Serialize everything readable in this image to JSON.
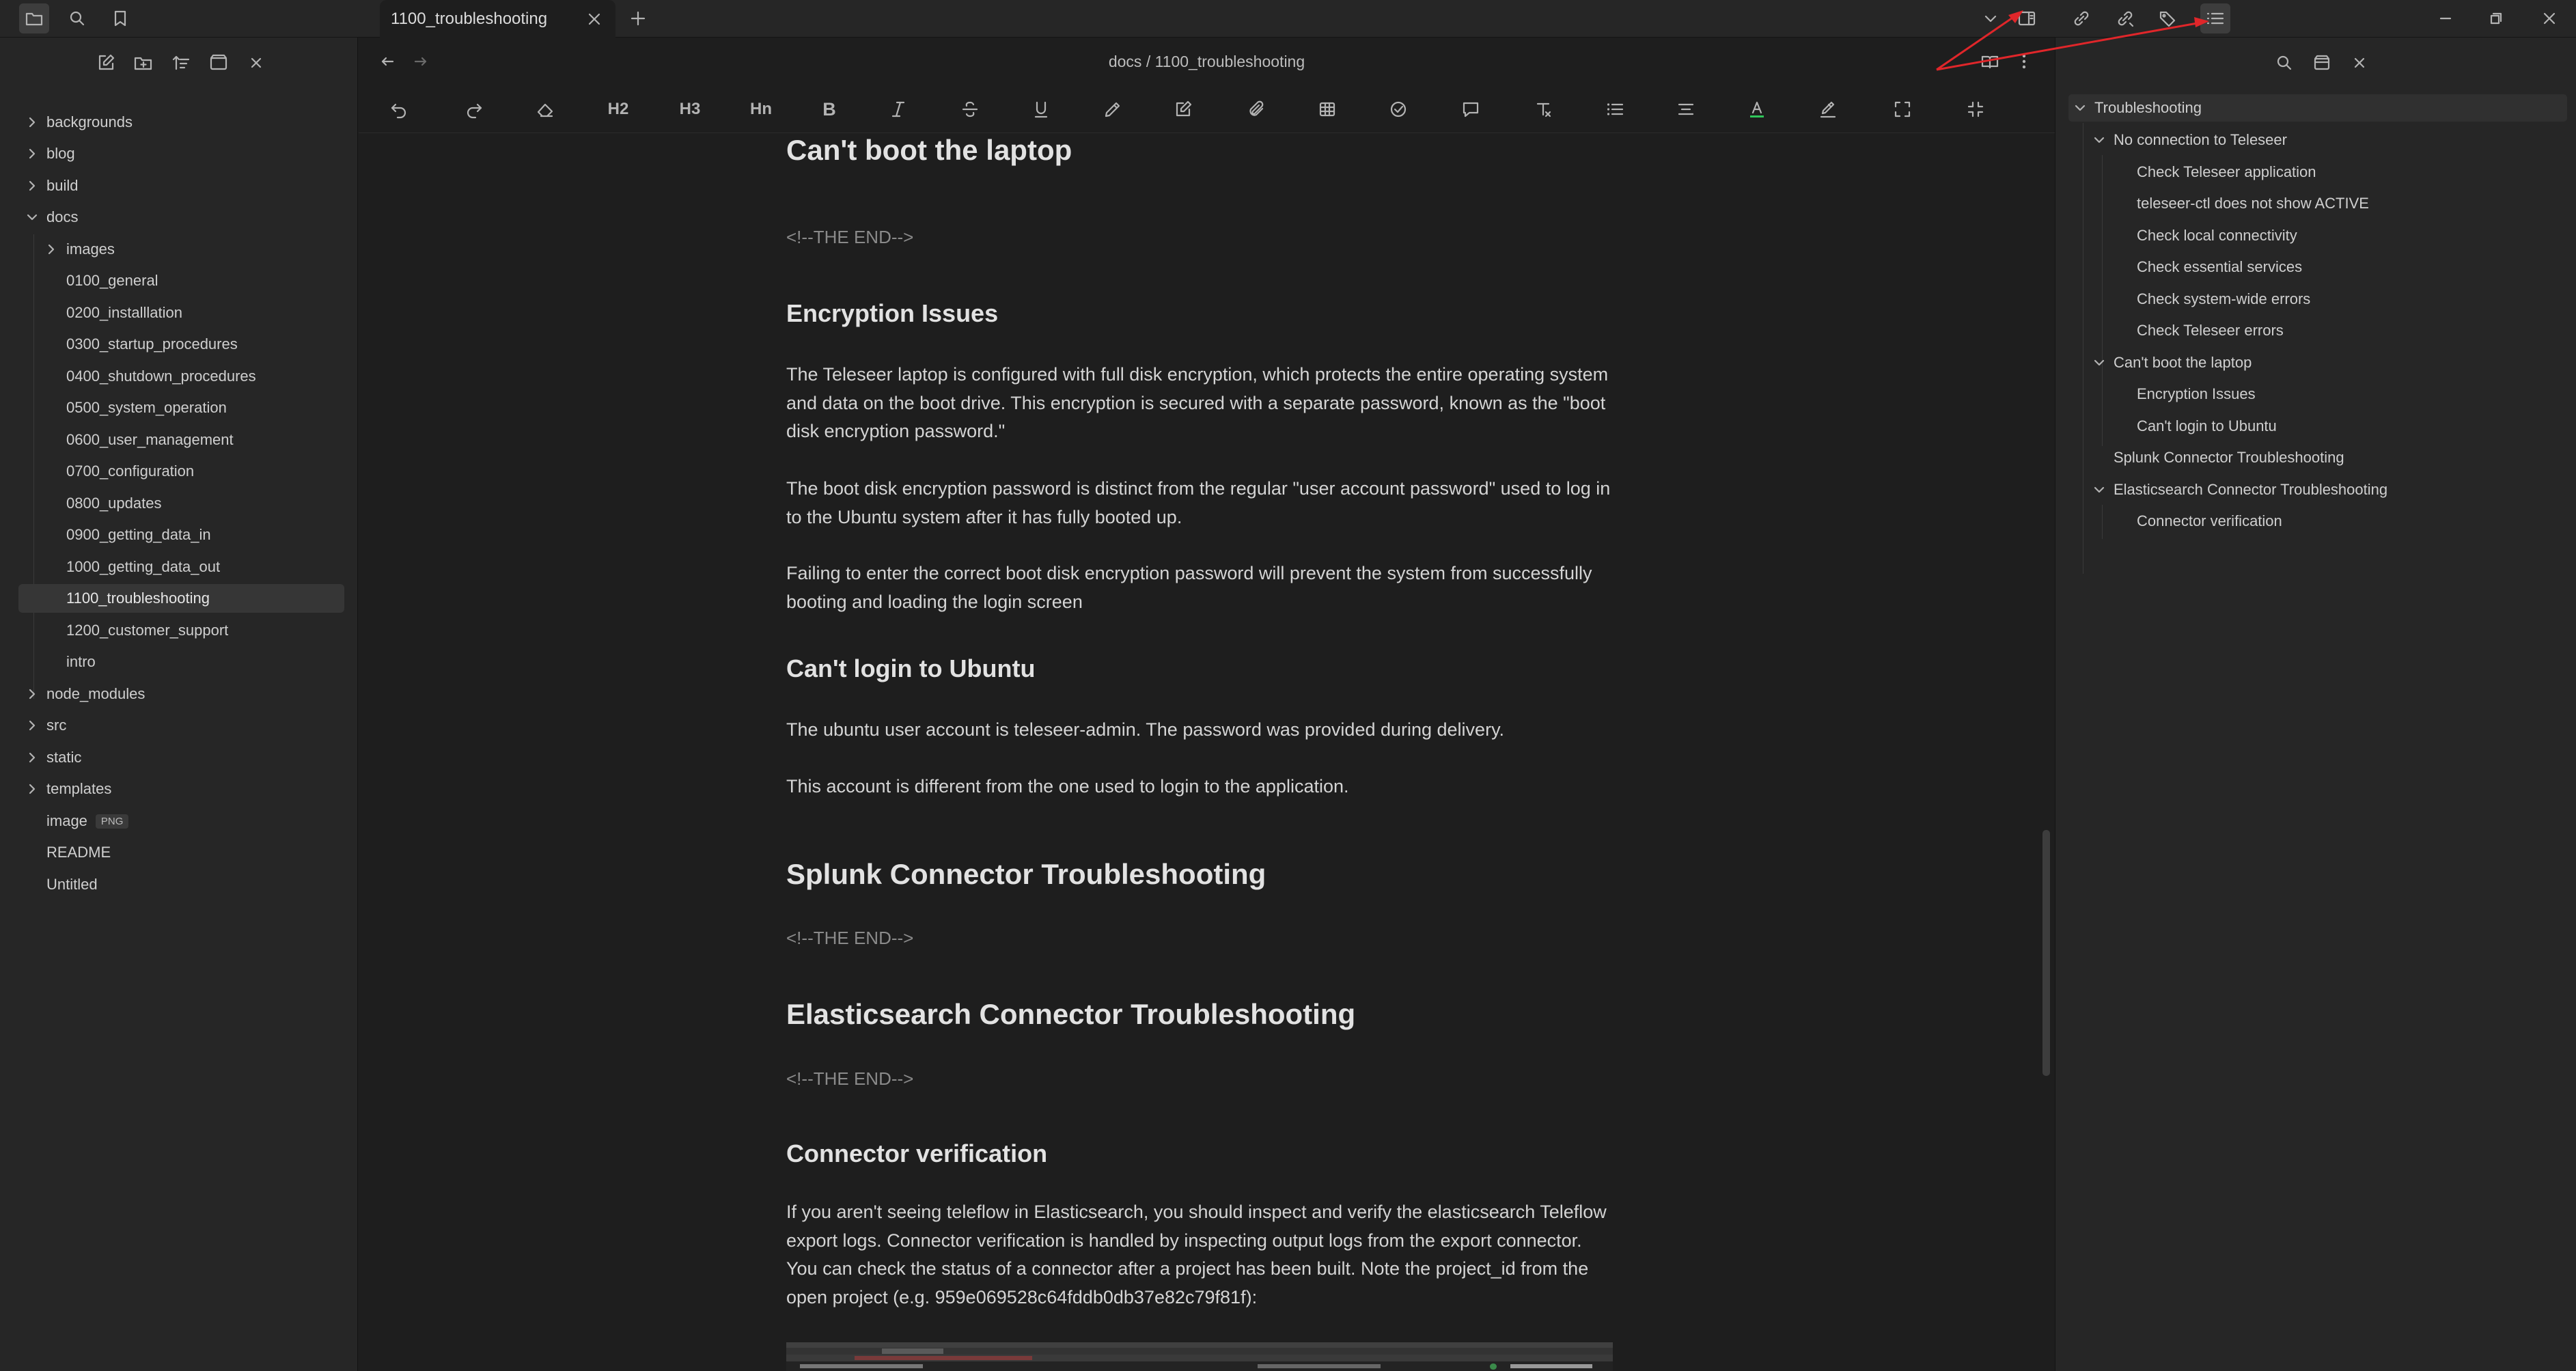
{
  "window": {
    "tab_title": "1100_troubleshooting"
  },
  "breadcrumb": {
    "text": "docs / 1100_troubleshooting"
  },
  "toolbar": {
    "h2": "H2",
    "h3": "H3",
    "hn": "Hn",
    "bold": "B"
  },
  "files": {
    "backgrounds": "backgrounds",
    "blog": "blog",
    "build": "build",
    "docs": "docs",
    "images": "images",
    "f0100": "0100_general",
    "f0200": "0200_installlation",
    "f0300": "0300_startup_procedures",
    "f0400": "0400_shutdown_procedures",
    "f0500": "0500_system_operation",
    "f0600": "0600_user_management",
    "f0700": "0700_configuration",
    "f0800": "0800_updates",
    "f0900": "0900_getting_data_in",
    "f1000": "1000_getting_data_out",
    "f1100": "1100_troubleshooting",
    "f1200": "1200_customer_support",
    "intro": "intro",
    "node_modules": "node_modules",
    "src": "src",
    "static": "static",
    "templates": "templates",
    "image": "image",
    "image_badge": "PNG",
    "readme": "README",
    "untitled": "Untitled"
  },
  "doc": {
    "h_boot": "Can't boot the laptop",
    "end1": "<!--THE END-->",
    "h_enc": "Encryption Issues",
    "p_enc1": "The Teleseer laptop is configured with full disk encryption, which protects the entire operating system and data on the boot drive. This encryption is secured with a separate password, known as the \"boot disk encryption password.\"",
    "p_enc2": "The boot disk encryption password is distinct from the regular \"user account password\" used to log in to the Ubuntu system after it has fully booted up.",
    "p_enc3": "Failing to enter the correct boot disk encryption password will prevent the system from successfully booting and loading the login screen",
    "h_login": "Can't login to Ubuntu",
    "p_login1": "The ubuntu user account is teleseer-admin.  The password was provided during delivery.",
    "p_login2": "This account is different from the one used to login to the application.",
    "h_splunk": "Splunk Connector Troubleshooting",
    "end2": "<!--THE END-->",
    "h_elastic": "Elasticsearch Connector Troubleshooting",
    "end3": "<!--THE END-->",
    "h_verif": "Connector verification",
    "p_verif": "If you aren't seeing teleflow in Elasticsearch, you should inspect and verify the elasticsearch Teleflow export logs.  Connector verification is handled by inspecting output logs from the export connector.  You can check the status of a connector after a project has been built.  Note the project_id from the open project (e.g. 959e069528c64fddb0db37e82c79f81f):"
  },
  "outline": {
    "root": "Troubleshooting",
    "no_conn": "No connection to Teleseer",
    "check_app": "Check Teleseer application",
    "ctl": "teleseer-ctl does not show ACTIVE",
    "local": "Check local connectivity",
    "essential": "Check essential services",
    "syswide": "Check system-wide errors",
    "tele_err": "Check Teleseer errors",
    "boot": "Can't boot the laptop",
    "enc": "Encryption Issues",
    "login": "Can't login to Ubuntu",
    "splunk": "Splunk Connector Troubleshooting",
    "elastic": "Elasticsearch Connector Troubleshooting",
    "verif": "Connector verification"
  },
  "colors": {
    "annotation_arrow": "#e0262a",
    "text_color_underline": "#2fc65a"
  }
}
